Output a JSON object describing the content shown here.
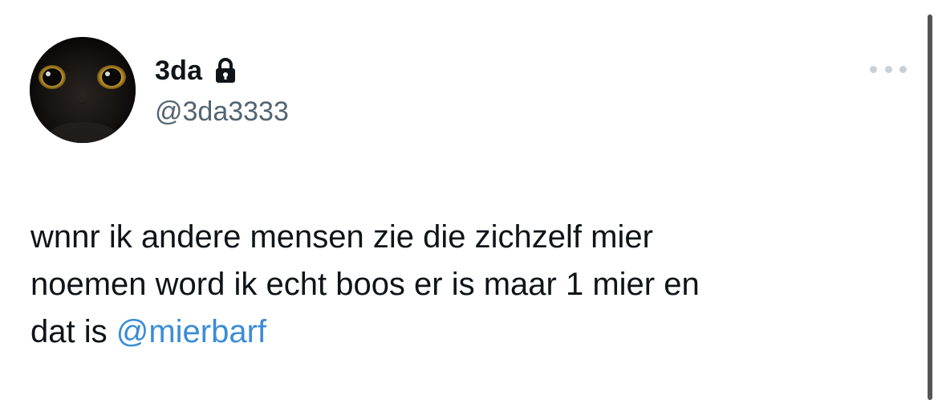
{
  "tweet": {
    "author": {
      "display_name": "3da",
      "handle": "@3da3333",
      "protected_icon": "lock-icon",
      "avatar_icon": "black-cat-avatar"
    },
    "more_icon": "more-horizontal-icon",
    "text": {
      "line1": "wnnr ik andere mensen zie die zichzelf mier",
      "line2": "noemen word ik echt boos er is maar 1 mier en",
      "line3_prefix": "dat is ",
      "mention": "@mierbarf"
    }
  },
  "colors": {
    "text": "#0f1419",
    "secondary": "#536471",
    "link": "#3b8cd6",
    "more_dots": "#c9d0d6"
  }
}
